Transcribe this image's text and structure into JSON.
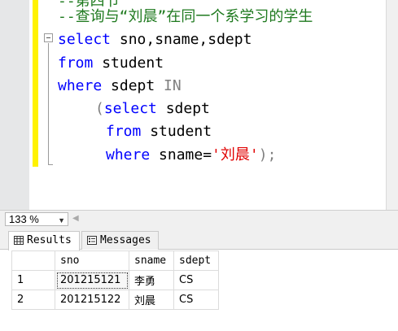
{
  "editor": {
    "comment_cut": "--第四节",
    "comment": "--查询与“刘晨”在同一个系学习的学生",
    "l1": {
      "kw": "select",
      "rest": " sno,sname,sdept"
    },
    "l2": {
      "kw": "from",
      "rest": " student"
    },
    "l3": {
      "kw": "where",
      "rest": " sdept ",
      "in": "IN"
    },
    "l4": {
      "paren": "(",
      "kw": "select",
      "rest": " sdept"
    },
    "l5": {
      "kw": "from",
      "rest": " student"
    },
    "l6": {
      "kw": "where",
      "rest": " sname=",
      "str": "'刘晨'",
      "tail": ");"
    }
  },
  "zoom": {
    "value": "133 %"
  },
  "tabs": {
    "results": "Results",
    "messages": "Messages"
  },
  "grid": {
    "columns": [
      "sno",
      "sname",
      "sdept"
    ],
    "rows": [
      {
        "num": "1",
        "sno": "201215121",
        "sname": "李勇",
        "sdept": "CS"
      },
      {
        "num": "2",
        "sno": "201215122",
        "sname": "刘晨",
        "sdept": "CS"
      }
    ]
  }
}
